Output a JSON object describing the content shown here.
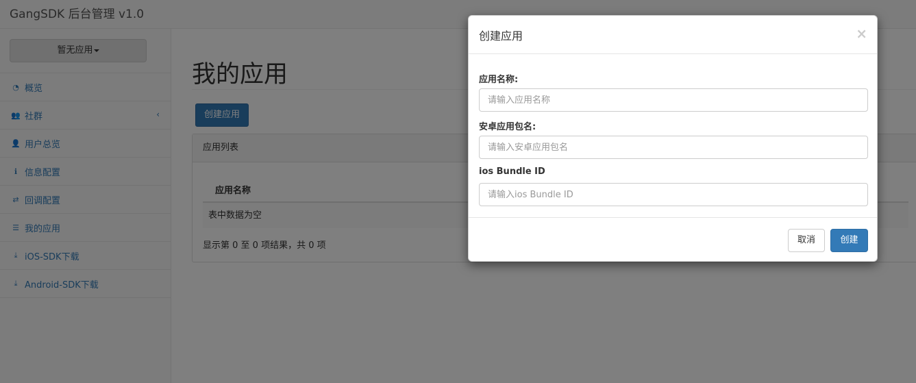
{
  "navbar": {
    "brand": "GangSDK 后台管理 v1.0"
  },
  "sidebar": {
    "app_selector": "暂无应用",
    "items": [
      {
        "label": "概览",
        "icon": "dashboard-icon",
        "glyph": "◔"
      },
      {
        "label": "社群",
        "icon": "users-icon",
        "glyph": "👥",
        "arrow": "‹"
      },
      {
        "label": "用户总览",
        "icon": "user-icon",
        "glyph": "👤"
      },
      {
        "label": "信息配置",
        "icon": "info-icon",
        "glyph": "ℹ"
      },
      {
        "label": "回调配置",
        "icon": "retweet-icon",
        "glyph": "⇄"
      },
      {
        "label": "我的应用",
        "icon": "list-icon",
        "glyph": "☰"
      },
      {
        "label": "iOS-SDK下载",
        "icon": "download-icon",
        "glyph": "⤓"
      },
      {
        "label": "Android-SDK下载",
        "icon": "download-icon",
        "glyph": "⤓"
      }
    ]
  },
  "main": {
    "title": "我的应用",
    "create_button": "创建应用",
    "panel": {
      "heading": "应用列表",
      "column_header": "应用名称",
      "empty_text": "表中数据为空",
      "info_text": "显示第 0 至 0 项结果，共 0 项"
    }
  },
  "modal": {
    "title": "创建应用",
    "close": "×",
    "fields": [
      {
        "label": "应用名称:",
        "placeholder": "请输入应用名称",
        "value": ""
      },
      {
        "label": "安卓应用包名:",
        "placeholder": "请输入安卓应用包名",
        "value": ""
      },
      {
        "label": "ios Bundle ID",
        "placeholder": "请输入ios Bundle ID",
        "value": ""
      }
    ],
    "cancel_label": "取消",
    "confirm_label": "创建"
  },
  "colors": {
    "primary": "#337ab7",
    "link": "#337ab7",
    "backdrop": "rgba(0,0,0,0.5)"
  }
}
